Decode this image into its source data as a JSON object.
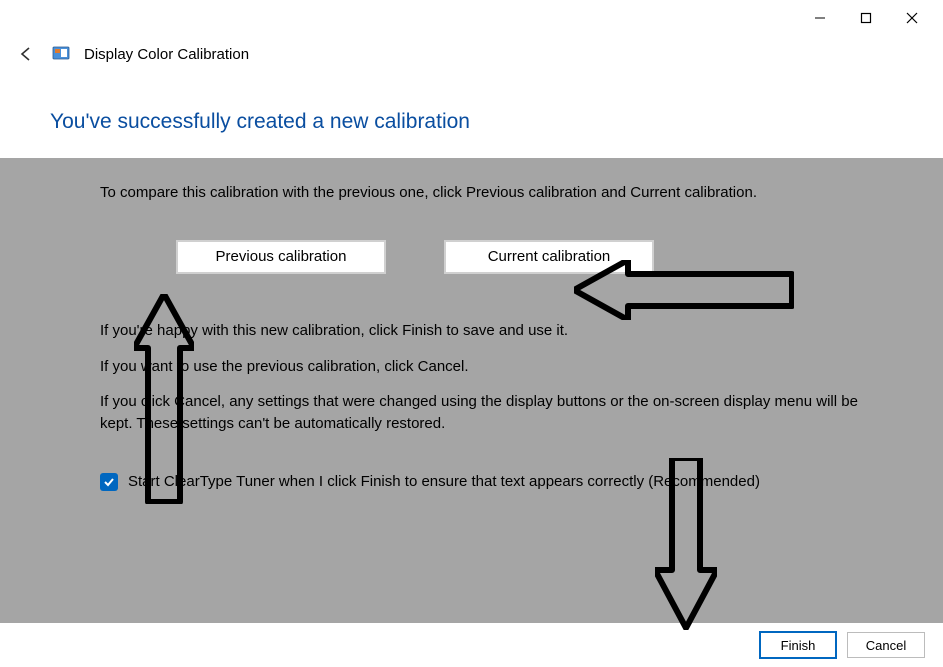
{
  "window": {
    "app_title": "Display Color Calibration"
  },
  "heading": "You've successfully created a new calibration",
  "content": {
    "intro": "To compare this calibration with the previous one, click Previous calibration and Current calibration.",
    "prev_btn": "Previous calibration",
    "curr_btn": "Current calibration",
    "line1": "If you're happy with this new calibration, click Finish to save and use it.",
    "line2": "If you want to use the previous calibration, click Cancel.",
    "line3": "If you click Cancel, any settings that were changed using the display buttons or the on-screen display menu will be kept. These settings can't be automatically restored.",
    "checkbox_label": "Start ClearType Tuner when I click Finish to ensure that text appears correctly (Recommended)",
    "checkbox_checked": true
  },
  "footer": {
    "finish": "Finish",
    "cancel": "Cancel"
  }
}
